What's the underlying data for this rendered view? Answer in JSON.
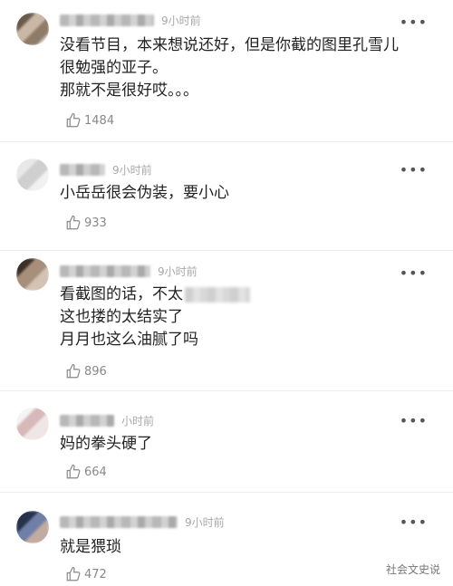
{
  "comments": [
    {
      "time": "9小时前",
      "lines": [
        "没看节目，本来想说还好，但是你截的图里孔雪儿",
        "很勉强的亚子。",
        "那就不是很好哎。。。"
      ],
      "likes": "1484",
      "more": "•••"
    },
    {
      "time": "9小时前",
      "lines": [
        "小岳岳很会伪装，要小心"
      ],
      "likes": "933",
      "more": "•••"
    },
    {
      "time": "9小时前",
      "lines": [
        "看截图的话，不太",
        "这也搂的太结实了",
        "月月也这么油腻了吗"
      ],
      "likes": "896",
      "more": "•••"
    },
    {
      "time": "小时前",
      "lines": [
        "妈的拳头硬了"
      ],
      "likes": "664",
      "more": "•••"
    },
    {
      "time": "9小时前",
      "lines": [
        "就是猥琐"
      ],
      "likes": "472",
      "more": "•••"
    }
  ],
  "watermark": "社会文史说",
  "icons": {
    "like": "thumbs-up-icon",
    "more": "more-options-icon"
  }
}
